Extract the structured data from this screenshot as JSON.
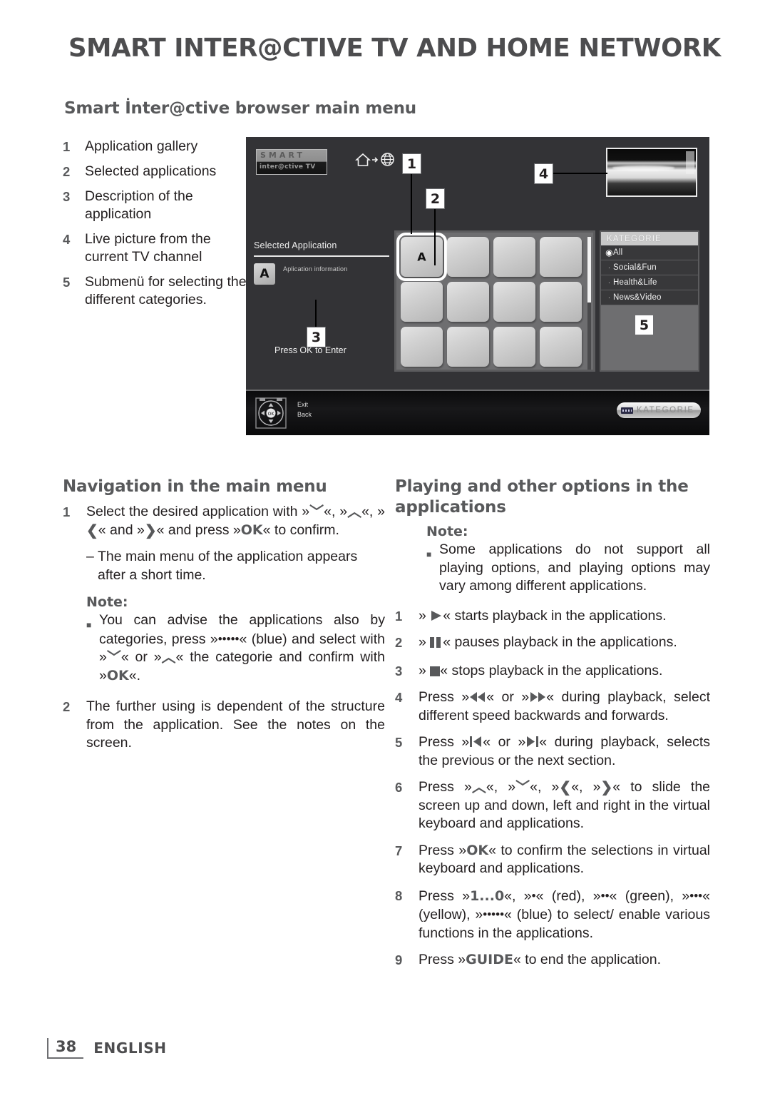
{
  "document": {
    "header_title": "SMART INTER@CTIVE TV AND HOME NETWORK",
    "section_title": "Smart İnter@ctive browser main menu"
  },
  "legend": {
    "items": [
      {
        "num": "1",
        "text": "Application gallery"
      },
      {
        "num": "2",
        "text": "Selected applications"
      },
      {
        "num": "3",
        "text": "Description of the application"
      },
      {
        "num": "4",
        "text": "Live picture from the current TV channel"
      },
      {
        "num": "5",
        "text": "Submenü for selecting the different categories."
      }
    ]
  },
  "diagram": {
    "logo_line1": "SMART",
    "logo_line2": "inter@ctive TV",
    "home_icon": "home-icon",
    "globe_icon": "globe-icon",
    "callouts": [
      {
        "num": "1"
      },
      {
        "num": "2"
      },
      {
        "num": "3"
      },
      {
        "num": "4"
      },
      {
        "num": "5"
      }
    ],
    "selected_application_title": "Selected Application",
    "selected_application_tile": "A",
    "application_information": "Aplication information",
    "press_ok": "Press OK to Enter",
    "grid_selected_label": "A",
    "categories": {
      "header": "KATEGORIE",
      "items": [
        {
          "label": "All",
          "selected": true
        },
        {
          "label": "Social&Fun",
          "selected": false
        },
        {
          "label": "Health&Life",
          "selected": false
        },
        {
          "label": "News&Video",
          "selected": false
        }
      ]
    },
    "bottom_bar": {
      "exit_label": "Exit",
      "back_label": "Back",
      "ok_label": "OK",
      "kategorie_button": "KATEGORIE"
    }
  },
  "navigation": {
    "heading": "Navigation in the main menu",
    "step1_a": "Select the desired application with »",
    "step1_b": "«, »",
    "step1_c": "«, »",
    "step1_d": "« and »",
    "step1_e": "« and press »",
    "step1_f": "« to confirm.",
    "step1_sub": "The main menu of the application appears after a short time.",
    "note_heading": "Note:",
    "note_a": "You can advise the applications also by categories, press »",
    "note_blue_dots": "•••••",
    "note_b": "« (blue) and select with »",
    "note_c": "« or »",
    "note_d": "« the categorie and confirm with »",
    "note_e": "«.",
    "step2": "The further using is dependent of the structure from the application. See the notes on the screen.",
    "key_ok": "OK"
  },
  "playing": {
    "heading": "Playing and other options in the applications",
    "note_heading": "Note:",
    "note_text": "Some applications do not support all playing options, and playing options may vary among different applications.",
    "items": [
      {
        "num": "1",
        "pre": "»",
        "icon": "play-icon",
        "post": "« starts playback in the applications."
      },
      {
        "num": "2",
        "pre": "»",
        "icon": "pause-icon",
        "post": "« pauses playback in the applications."
      },
      {
        "num": "3",
        "pre": "»",
        "icon": "stop-icon",
        "post": "« stops playback in the applications."
      },
      {
        "num": "4",
        "pre": "Press »",
        "icon": "rewind-icon",
        "mid": "« or »",
        "icon2": "fast-forward-icon",
        "post": "« during playback, select different speed backwards and forwards."
      },
      {
        "num": "5",
        "pre": "Press »",
        "icon": "previous-section-icon",
        "mid": "« or »",
        "icon2": "next-section-icon",
        "post": "« during playback, selects the previous or the next section."
      },
      {
        "num": "6",
        "pre": "Press »",
        "icon": "up-arrow-icon",
        "mid1": "«, »",
        "icon2": "down-arrow-icon",
        "mid2": "«, »",
        "icon3": "left-arrow-icon",
        "mid3": "«, »",
        "icon4": "right-arrow-icon",
        "post": "« to slide the screen up and down, left and right in the virtual keyboard and applications."
      },
      {
        "num": "7",
        "pre": "Press »",
        "key": "OK",
        "post": "« to confirm the selections in virtual keyboard and applications."
      },
      {
        "num": "8",
        "pre": "Press »",
        "key": "1...0",
        "mid1": "«, »",
        "red_dots": "•",
        "mid2": "« (red), »",
        "green_dots": "••",
        "mid3": "« (green), »",
        "yellow_dots": "•••",
        "mid4": "« (yellow), »",
        "blue_dots": "•••••",
        "post": "« (blue) to select/ enable various functions in the applications."
      },
      {
        "num": "9",
        "pre": "Press »",
        "key": "GUIDE",
        "post": "« to end the application."
      }
    ]
  },
  "footer": {
    "page_number": "38",
    "language": "ENGLISH"
  }
}
